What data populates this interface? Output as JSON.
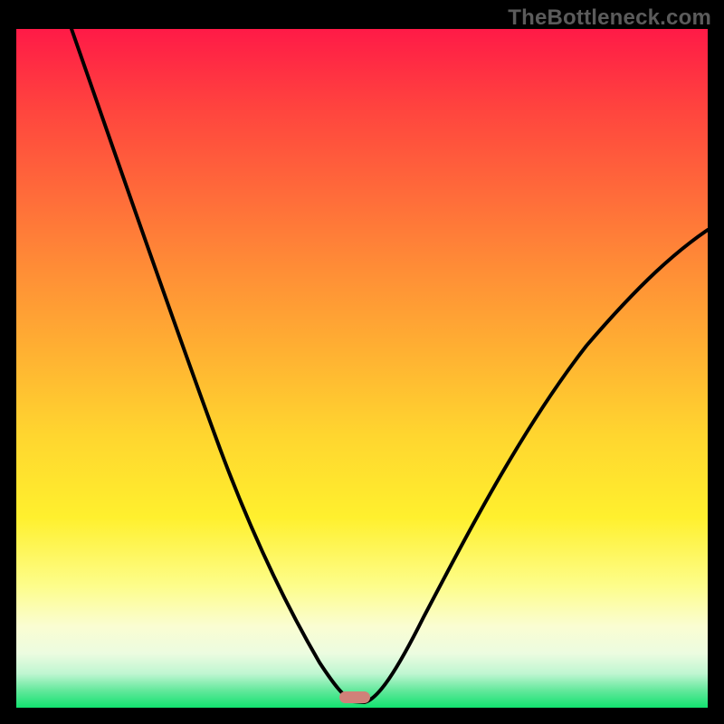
{
  "watermark": "TheBottleneck.com",
  "colors": {
    "curve_stroke": "#000000",
    "marker_fill": "#d08179",
    "frame_bg": "#000000"
  },
  "gradient_stops": [
    {
      "pos": 0,
      "color": "#ff1a47"
    },
    {
      "pos": 0.12,
      "color": "#ff453e"
    },
    {
      "pos": 0.24,
      "color": "#ff6a3a"
    },
    {
      "pos": 0.36,
      "color": "#ff8f36"
    },
    {
      "pos": 0.48,
      "color": "#ffb232"
    },
    {
      "pos": 0.6,
      "color": "#ffd62f"
    },
    {
      "pos": 0.72,
      "color": "#fff02e"
    },
    {
      "pos": 0.82,
      "color": "#fdfd8a"
    },
    {
      "pos": 0.88,
      "color": "#fafdd2"
    },
    {
      "pos": 0.92,
      "color": "#ecfce0"
    },
    {
      "pos": 0.95,
      "color": "#bff6d1"
    },
    {
      "pos": 0.975,
      "color": "#62e89b"
    },
    {
      "pos": 1.0,
      "color": "#12e26f"
    }
  ],
  "chart_data": {
    "type": "line",
    "title": "",
    "xlabel": "",
    "ylabel": "",
    "xlim": [
      0,
      100
    ],
    "ylim": [
      0,
      100
    ],
    "comment": "x is normalized horizontal position (0-100); y is normalized bottleneck percentage (0 = none/green, 100 = top/red). Single V-shaped curve with minimum near x≈49.",
    "series": [
      {
        "name": "bottleneck-curve",
        "x": [
          8,
          12,
          16,
          20,
          24,
          28,
          32,
          36,
          40,
          44,
          46,
          48,
          49,
          50,
          52,
          56,
          60,
          64,
          68,
          72,
          76,
          80,
          84,
          88,
          92,
          96,
          100
        ],
        "y": [
          100,
          90,
          82,
          74,
          66,
          58,
          50,
          41,
          31,
          18,
          11,
          4,
          1,
          2,
          6,
          14,
          21,
          28,
          34,
          40,
          46,
          51,
          56,
          60,
          64,
          67,
          70
        ]
      }
    ],
    "marker": {
      "x": 49,
      "y": 1,
      "shape": "rounded-bar"
    }
  }
}
